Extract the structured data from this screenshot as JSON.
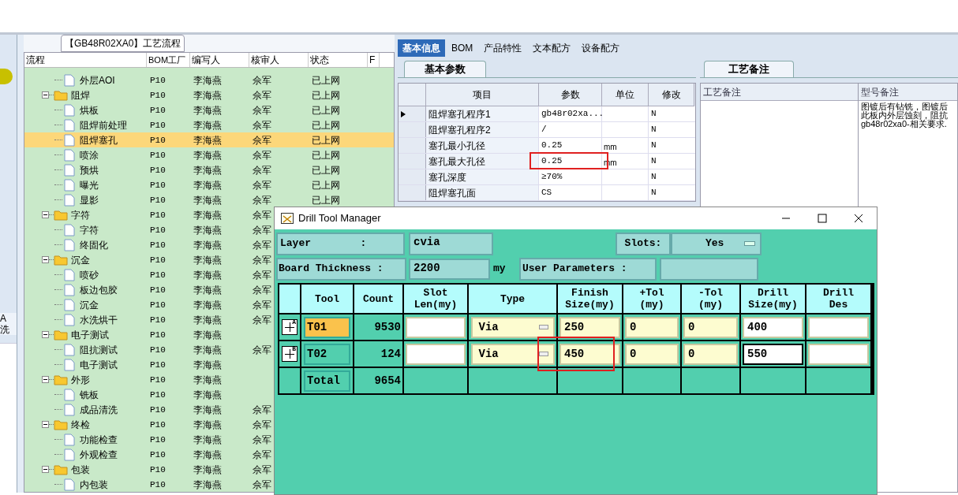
{
  "left_strip": {
    "texts": [
      "A",
      "洗"
    ]
  },
  "flow_panel": {
    "title": "【GB48R02XA0】工艺流程",
    "columns": [
      "流程",
      "BOM工厂",
      "编写人",
      "核审人",
      "状态",
      "F"
    ],
    "tree": [
      {
        "kind": "item",
        "label": "外层AOI",
        "bom": "P10",
        "writer": "李海燕",
        "reviewer": "佘军",
        "status": "已上网",
        "selected": false
      },
      {
        "kind": "folder",
        "label": "阻焊",
        "bom": "P10",
        "writer": "李海燕",
        "reviewer": "佘军",
        "status": "已上网",
        "selected": false,
        "expanded": true,
        "children": [
          {
            "kind": "item",
            "label": "烘板",
            "bom": "P10",
            "writer": "李海燕",
            "reviewer": "佘军",
            "status": "已上网",
            "selected": false
          },
          {
            "kind": "item",
            "label": "阻焊前处理",
            "bom": "P10",
            "writer": "李海燕",
            "reviewer": "佘军",
            "status": "已上网",
            "selected": false
          },
          {
            "kind": "item",
            "label": "阻焊塞孔",
            "bom": "P10",
            "writer": "李海燕",
            "reviewer": "佘军",
            "status": "已上网",
            "selected": true
          },
          {
            "kind": "item",
            "label": "喷涂",
            "bom": "P10",
            "writer": "李海燕",
            "reviewer": "佘军",
            "status": "已上网",
            "selected": false
          },
          {
            "kind": "item",
            "label": "预烘",
            "bom": "P10",
            "writer": "李海燕",
            "reviewer": "佘军",
            "status": "已上网",
            "selected": false
          },
          {
            "kind": "item",
            "label": "曝光",
            "bom": "P10",
            "writer": "李海燕",
            "reviewer": "佘军",
            "status": "已上网",
            "selected": false
          },
          {
            "kind": "item",
            "label": "显影",
            "bom": "P10",
            "writer": "李海燕",
            "reviewer": "佘军",
            "status": "已上网",
            "selected": false
          }
        ]
      },
      {
        "kind": "folder",
        "label": "字符",
        "bom": "P10",
        "writer": "李海燕",
        "reviewer": "佘军",
        "selected": false,
        "expanded": true,
        "children": [
          {
            "kind": "item",
            "label": "字符",
            "bom": "P10",
            "writer": "李海燕",
            "reviewer": "佘军",
            "selected": false
          },
          {
            "kind": "item",
            "label": "终固化",
            "bom": "P10",
            "writer": "李海燕",
            "reviewer": "佘军",
            "selected": false
          }
        ]
      },
      {
        "kind": "folder",
        "label": "沉金",
        "bom": "P10",
        "writer": "李海燕",
        "reviewer": "佘军",
        "selected": false,
        "expanded": true,
        "children": [
          {
            "kind": "item",
            "label": "喷砂",
            "bom": "P10",
            "writer": "李海燕",
            "reviewer": "佘军",
            "selected": false
          },
          {
            "kind": "item",
            "label": "板边包胶",
            "bom": "P10",
            "writer": "李海燕",
            "reviewer": "佘军",
            "selected": false
          },
          {
            "kind": "item",
            "label": "沉金",
            "bom": "P10",
            "writer": "李海燕",
            "reviewer": "佘军",
            "selected": false
          },
          {
            "kind": "item",
            "label": "水洗烘干",
            "bom": "P10",
            "writer": "李海燕",
            "reviewer": "佘军",
            "selected": false
          }
        ]
      },
      {
        "kind": "folder",
        "label": "电子测试",
        "bom": "P10",
        "writer": "李海燕",
        "selected": false,
        "expanded": true,
        "children": [
          {
            "kind": "item",
            "label": "阻抗测试",
            "bom": "P10",
            "writer": "李海燕",
            "reviewer": "佘军",
            "selected": false
          },
          {
            "kind": "item",
            "label": "电子测试",
            "bom": "P10",
            "writer": "李海燕",
            "selected": false
          }
        ]
      },
      {
        "kind": "folder",
        "label": "外形",
        "bom": "P10",
        "writer": "李海燕",
        "selected": false,
        "expanded": true,
        "children": [
          {
            "kind": "item",
            "label": "铣板",
            "bom": "P10",
            "writer": "李海燕",
            "selected": false
          },
          {
            "kind": "item",
            "label": "成品清洗",
            "bom": "P10",
            "writer": "李海燕",
            "reviewer": "佘军",
            "selected": false
          }
        ]
      },
      {
        "kind": "folder",
        "label": "终检",
        "bom": "P10",
        "writer": "李海燕",
        "reviewer": "佘军",
        "selected": false,
        "expanded": true,
        "children": [
          {
            "kind": "item",
            "label": "功能检查",
            "bom": "P10",
            "writer": "李海燕",
            "reviewer": "佘军",
            "selected": false
          },
          {
            "kind": "item",
            "label": "外观检查",
            "bom": "P10",
            "writer": "李海燕",
            "reviewer": "佘军",
            "selected": false
          }
        ]
      },
      {
        "kind": "folder",
        "label": "包装",
        "bom": "P10",
        "writer": "李海燕",
        "reviewer": "佘军",
        "selected": false,
        "expanded": true,
        "children": [
          {
            "kind": "item",
            "label": "内包装",
            "bom": "P10",
            "writer": "李海燕",
            "reviewer": "佘军",
            "selected": false
          }
        ]
      }
    ]
  },
  "info_panel": {
    "tabs": [
      {
        "label": "基本信息",
        "selected": true
      },
      {
        "label": "BOM",
        "selected": false
      },
      {
        "label": "产品特性",
        "selected": false
      },
      {
        "label": "文本配方",
        "selected": false
      },
      {
        "label": "设备配方",
        "selected": false
      }
    ],
    "params": {
      "tab": "基本参数",
      "columns": [
        "项目",
        "参数",
        "单位",
        "修改"
      ],
      "rows": [
        {
          "item": "阻焊塞孔程序1",
          "value": "gb48r02xa...",
          "unit": "",
          "modified": "N",
          "current": true,
          "highlighted": false
        },
        {
          "item": "阻焊塞孔程序2",
          "value": "/",
          "unit": "",
          "modified": "N",
          "current": false,
          "highlighted": false
        },
        {
          "item": "塞孔最小孔径",
          "value": "0.25",
          "unit": "mm",
          "modified": "N",
          "current": false,
          "highlighted": false
        },
        {
          "item": "塞孔最大孔径",
          "value": "0.25",
          "unit": "mm",
          "modified": "N",
          "current": false,
          "highlighted": true
        },
        {
          "item": "塞孔深度",
          "value": "≥70%",
          "unit": "",
          "modified": "N",
          "current": false,
          "highlighted": false
        },
        {
          "item": "阻焊塞孔面",
          "value": "CS",
          "unit": "",
          "modified": "N",
          "current": false,
          "highlighted": false
        }
      ]
    },
    "notes": {
      "tab": "工艺备注",
      "columns": [
        "工艺备注",
        "型号备注"
      ],
      "model_note": [
        "图镀后有钻铣，图镀后",
        "此板内外层蚀刻，阻抗",
        "gb48r02xa0-相关要求."
      ]
    }
  },
  "dialog": {
    "title": "Drill Tool Manager",
    "layer_label": "Layer        :",
    "layer": "cvia",
    "slots_label": "Slots:",
    "slots": "Yes",
    "thickness_label": "Board Thickness :",
    "thickness": "2200",
    "thickness_unit": "my",
    "user_params_label": "User Parameters :",
    "columns": [
      "",
      "Tool",
      "Count",
      "Slot\nLen(my)",
      "Type",
      "Finish\nSize(my)",
      "+Tol\n(my)",
      "-Tol\n(my)",
      "Drill\nSize(my)",
      "Drill\nDes"
    ],
    "tools": [
      {
        "expand": "A",
        "tool": "T01",
        "count": "9530",
        "type": "Via",
        "finish": "250",
        "plus_tol": "0",
        "minus_tol": "0",
        "drill": "400",
        "selected": true,
        "highlighted": false,
        "drill_focused": false
      },
      {
        "expand": "B",
        "tool": "T02",
        "count": "124",
        "type": "Via",
        "finish": "450",
        "plus_tol": "0",
        "minus_tol": "0",
        "drill": "550",
        "selected": false,
        "highlighted": true,
        "drill_focused": true
      }
    ],
    "total": {
      "label": "Total",
      "count": "9654"
    }
  }
}
